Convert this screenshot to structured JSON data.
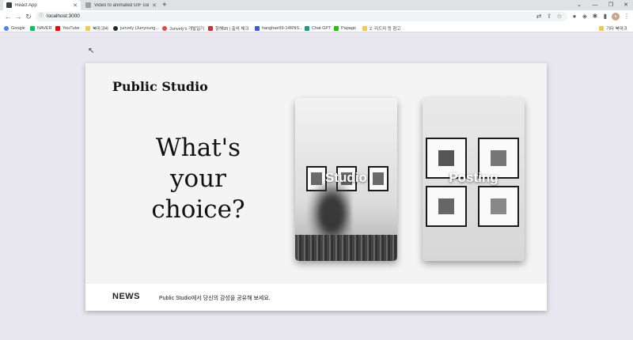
{
  "browser": {
    "tabs": [
      {
        "title": "React App",
        "active": true
      },
      {
        "title": "Video to animated GIF converte",
        "active": false
      }
    ],
    "new_tab_icon": "plus-icon",
    "url": "localhost:3000",
    "bookmarks": [
      {
        "label": "Google",
        "color": "#4285f4"
      },
      {
        "label": "NAVER",
        "color": "#03c75a"
      },
      {
        "label": "YouTube",
        "color": "#ff0000"
      },
      {
        "label": "북마크바",
        "color": "#f6c94b"
      },
      {
        "label": "junvely (Junyoung...",
        "color": "#24292e"
      },
      {
        "label": "Junvely's 개발일기",
        "color": "#e8453c"
      },
      {
        "label": "항해99 | 출석 체크",
        "color": "#d32f2f"
      },
      {
        "label": "hanghae99-14RNS...",
        "color": "#3b5bdb"
      },
      {
        "label": "Chat GPT",
        "color": "#10a37f"
      },
      {
        "label": "Papago",
        "color": "#1ec800"
      },
      {
        "label": "2. 리드미 등 참고",
        "color": "#f6c94b"
      }
    ],
    "other_bookmarks": "기타 북마크"
  },
  "page": {
    "brand": "Public Studio",
    "hero_lines": [
      "What's",
      "your",
      "choice?"
    ],
    "choices": [
      {
        "label": "Studio"
      },
      {
        "label": "Posting"
      }
    ],
    "news": {
      "title": "NEWS",
      "text": "Public Studio에서 당신의 감성을 공유해 보세요."
    }
  },
  "colors": {
    "page_background": "#e8e6ee",
    "card_background": "#f4f4f4",
    "text": "#111111"
  }
}
